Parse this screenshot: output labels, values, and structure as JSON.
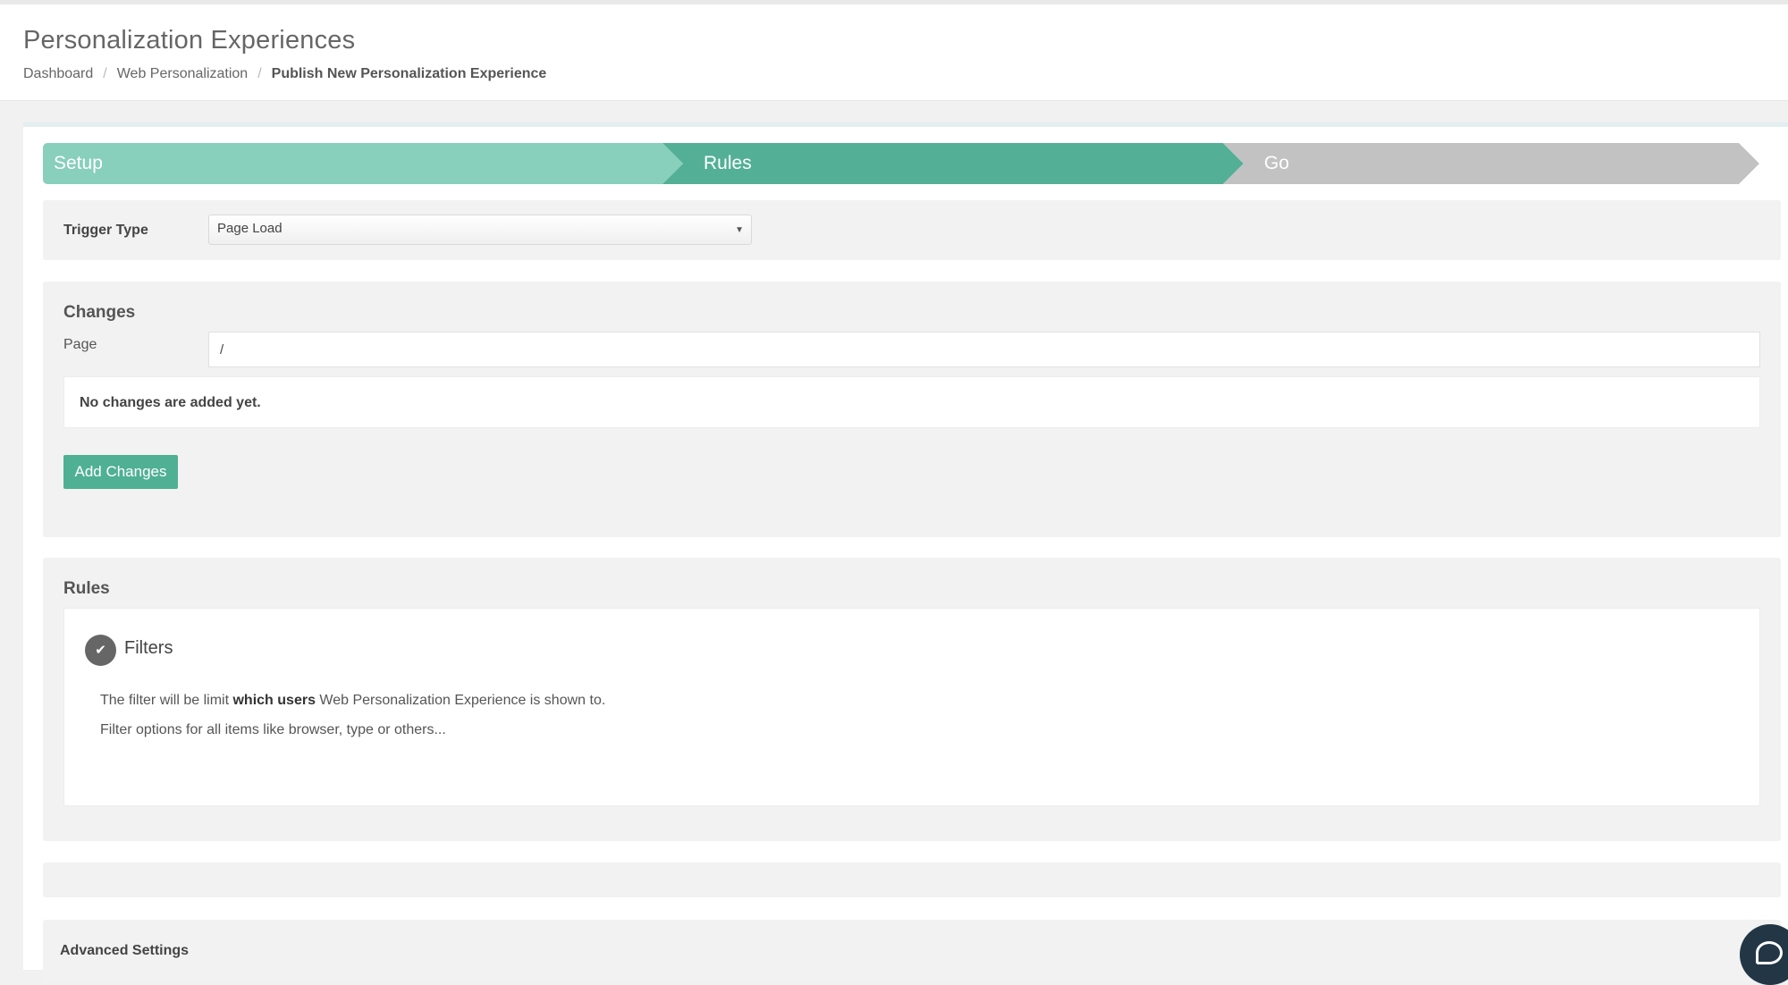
{
  "header": {
    "title": "Personalization Experiences",
    "breadcrumb": [
      "Dashboard",
      "Web Personalization",
      "Publish New Personalization Experience"
    ]
  },
  "steps": [
    {
      "label": "Setup",
      "state": "completed",
      "color": "#88cfbc"
    },
    {
      "label": "Rules",
      "state": "active",
      "color": "#53b096"
    },
    {
      "label": "Go",
      "state": "pending",
      "color": "#c2c2c2"
    }
  ],
  "trigger": {
    "label": "Trigger Type",
    "selected": "Page Load"
  },
  "changes": {
    "title": "Changes",
    "page_label": "Page",
    "page_value": "/",
    "empty_message": "No changes are added yet.",
    "add_button": "Add Changes"
  },
  "rules": {
    "title": "Rules",
    "filters_title": "Filters",
    "desc_prefix": "The filter will be limit ",
    "desc_bold": "which users",
    "desc_suffix": " Web Personalization Experience is shown to.",
    "desc2": "Filter options for all items like browser, type or others..."
  },
  "advanced": {
    "label": "Advanced Settings"
  },
  "icons": {
    "check": "check-icon",
    "dropdown": "dropdown-arrow-icon",
    "chat": "chat-icon"
  },
  "colors": {
    "accent": "#4fb093",
    "chat": "#233646"
  }
}
